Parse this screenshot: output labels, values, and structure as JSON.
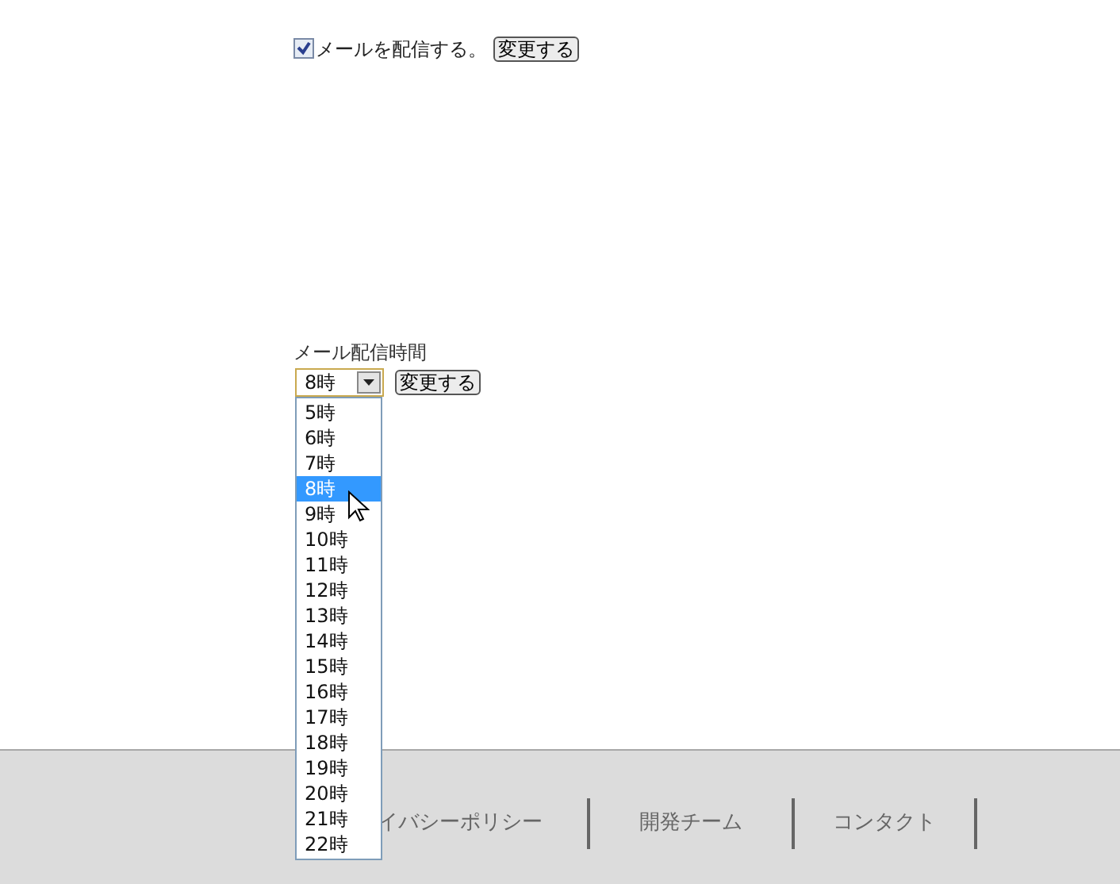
{
  "mail_setting": {
    "checked": true,
    "label": "メールを配信する。",
    "button": "変更する"
  },
  "delivery_time": {
    "label": "メール配信時間",
    "value": "8時",
    "button": "変更する",
    "options": [
      {
        "label": "5時",
        "selected": false
      },
      {
        "label": "6時",
        "selected": false
      },
      {
        "label": "7時",
        "selected": false
      },
      {
        "label": "8時",
        "selected": true
      },
      {
        "label": "9時",
        "selected": false
      },
      {
        "label": "10時",
        "selected": false
      },
      {
        "label": "11時",
        "selected": false
      },
      {
        "label": "12時",
        "selected": false
      },
      {
        "label": "13時",
        "selected": false
      },
      {
        "label": "14時",
        "selected": false
      },
      {
        "label": "15時",
        "selected": false
      },
      {
        "label": "16時",
        "selected": false
      },
      {
        "label": "17時",
        "selected": false
      },
      {
        "label": "18時",
        "selected": false
      },
      {
        "label": "19時",
        "selected": false
      },
      {
        "label": "20時",
        "selected": false
      },
      {
        "label": "21時",
        "selected": false
      },
      {
        "label": "22時",
        "selected": false
      }
    ]
  },
  "footer": {
    "links": [
      "イバシーポリシー",
      "開発チーム",
      "コンタクト"
    ]
  }
}
